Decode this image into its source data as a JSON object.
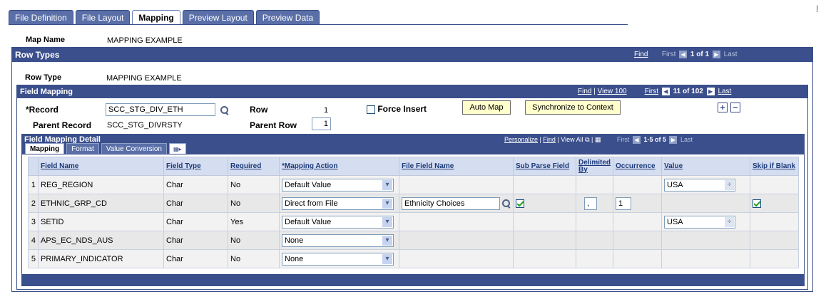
{
  "top_tabs": [
    {
      "label": "File Definition",
      "active": false
    },
    {
      "label": "File Layout",
      "active": false
    },
    {
      "label": "Mapping",
      "active": true
    },
    {
      "label": "Preview Layout",
      "active": false
    },
    {
      "label": "Preview Data",
      "active": false
    }
  ],
  "corner_mark": "I",
  "map_name": {
    "label": "Map Name",
    "value": "MAPPING EXAMPLE"
  },
  "row_types": {
    "title": "Row Types",
    "find": "Find",
    "first": "First",
    "range": "1 of 1",
    "last": "Last",
    "row_type_label": "Row Type",
    "row_type_value": "MAPPING EXAMPLE"
  },
  "field_mapping": {
    "title": "Field Mapping",
    "find": "Find",
    "view": "View 100",
    "first": "First",
    "range": "11 of 102",
    "last": "Last",
    "record_label": "*Record",
    "record_value": "SCC_STG_DIV_ETH",
    "row_label": "Row",
    "row_value": "1",
    "force_insert_label": "Force Insert",
    "auto_map": "Auto Map",
    "sync_context": "Synchronize to Context",
    "parent_record_label": "Parent Record",
    "parent_record_value": "SCC_STG_DIVRSTY",
    "parent_row_label": "Parent Row",
    "parent_row_value": "1"
  },
  "detail": {
    "title": "Field Mapping Detail",
    "personalize": "Personalize",
    "find": "Find",
    "view_all": "View All",
    "first": "First",
    "range": "1-5 of 5",
    "last": "Last",
    "tabs": [
      "Mapping",
      "Format",
      "Value Conversion"
    ],
    "columns": [
      "Field Name",
      "Field Type",
      "Required",
      "*Mapping Action",
      "File Field Name",
      "Sub Parse Field",
      "Delimited By",
      "Occurrence",
      "Value",
      "Skip if Blank"
    ],
    "rows": [
      {
        "num": "1",
        "field_name": "REG_REGION",
        "field_type": "Char",
        "required": "No",
        "action": "Default Value",
        "file_field": "",
        "sub_parse": false,
        "delimited": "",
        "occurrence": "",
        "value": "USA",
        "skip_blank": false
      },
      {
        "num": "2",
        "field_name": "ETHNIC_GRP_CD",
        "field_type": "Char",
        "required": "No",
        "action": "Direct from File",
        "file_field": "Ethnicity Choices",
        "sub_parse": true,
        "delimited": ",",
        "occurrence": "1",
        "value": "",
        "skip_blank": true
      },
      {
        "num": "3",
        "field_name": "SETID",
        "field_type": "Char",
        "required": "Yes",
        "action": "Default Value",
        "file_field": "",
        "sub_parse": false,
        "delimited": "",
        "occurrence": "",
        "value": "USA",
        "skip_blank": false
      },
      {
        "num": "4",
        "field_name": "APS_EC_NDS_AUS",
        "field_type": "Char",
        "required": "No",
        "action": "None",
        "file_field": "",
        "sub_parse": false,
        "delimited": "",
        "occurrence": "",
        "value": "",
        "skip_blank": false
      },
      {
        "num": "5",
        "field_name": "PRIMARY_INDICATOR",
        "field_type": "Char",
        "required": "No",
        "action": "None",
        "file_field": "",
        "sub_parse": false,
        "delimited": "",
        "occurrence": "",
        "value": "",
        "skip_blank": false
      }
    ]
  }
}
